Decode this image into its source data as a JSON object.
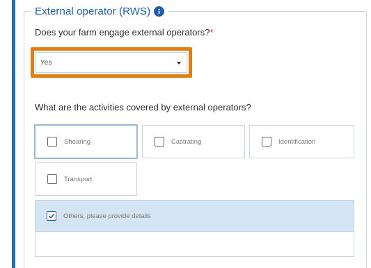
{
  "section": {
    "title": "External operator (RWS)",
    "info_icon": "info-circle-icon"
  },
  "q1": {
    "label": "Does your farm engage external operators?",
    "required_marker": "*",
    "selected_value": "Yes"
  },
  "q2": {
    "label": "What are the activities covered by external operators?",
    "options": [
      {
        "label": "Shearing",
        "checked": false
      },
      {
        "label": "Castrating",
        "checked": false
      },
      {
        "label": "Identification",
        "checked": false
      },
      {
        "label": "Transport",
        "checked": false
      }
    ],
    "others": {
      "label": "Others, please provide details",
      "checked": true,
      "details_value": ""
    }
  },
  "colors": {
    "accent": "#1f5fa6",
    "highlight": "#e37e13",
    "selected_panel": "#d5e4f3"
  }
}
